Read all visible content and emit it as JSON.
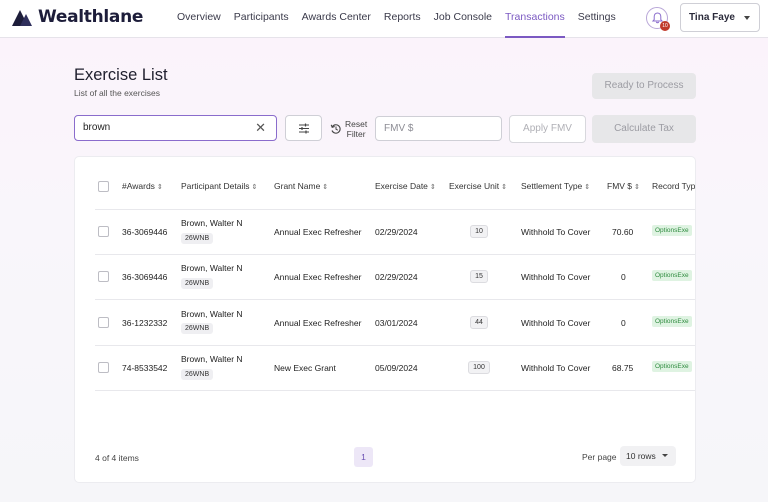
{
  "brand": {
    "name": "Wealthlane"
  },
  "nav": {
    "links": [
      "Overview",
      "Participants",
      "Awards Center",
      "Reports",
      "Job Console",
      "Transactions",
      "Settings"
    ],
    "active": "Transactions",
    "notification_count": "10",
    "user_name": "Tina Faye"
  },
  "page": {
    "title": "Exercise List",
    "subtitle": "List of all the exercises",
    "ready_button": "Ready to Process",
    "calculate_button": "Calculate Tax"
  },
  "toolbar": {
    "search_value": "brown",
    "reset_label_1": "Reset",
    "reset_label_2": "Filter",
    "fmv_placeholder": "FMV $",
    "apply_button": "Apply FMV"
  },
  "table": {
    "headers": [
      "#Awards",
      "Participant Details",
      "Grant Name",
      "Exercise Date",
      "Exercise Unit",
      "Settlement Type",
      "FMV $",
      "Record Typ"
    ],
    "rows": [
      {
        "award": "36-3069446",
        "name": "Brown, Walter N",
        "code": "26WNB",
        "grant": "Annual Exec Refresher",
        "date": "02/29/2024",
        "unit": "10",
        "settlement": "Withhold To Cover",
        "fmv": "70.60",
        "record": "OptionsExe"
      },
      {
        "award": "36-3069446",
        "name": "Brown, Walter N",
        "code": "26WNB",
        "grant": "Annual Exec Refresher",
        "date": "02/29/2024",
        "unit": "15",
        "settlement": "Withhold To Cover",
        "fmv": "0",
        "record": "OptionsExe"
      },
      {
        "award": "36-1232332",
        "name": "Brown, Walter N",
        "code": "26WNB",
        "grant": "Annual Exec Refresher",
        "date": "03/01/2024",
        "unit": "44",
        "settlement": "Withhold To Cover",
        "fmv": "0",
        "record": "OptionsExe"
      },
      {
        "award": "74-8533542",
        "name": "Brown, Walter N",
        "code": "26WNB",
        "grant": "New Exec Grant",
        "date": "05/09/2024",
        "unit": "100",
        "settlement": "Withhold To Cover",
        "fmv": "68.75",
        "record": "OptionsExe"
      }
    ]
  },
  "footer": {
    "count": "4 of 4 items",
    "page": "1",
    "per_page_label": "Per page",
    "rows_option": "10 rows"
  },
  "colors": {
    "accent": "#7b59c2",
    "brand_dark": "#1d1d3a",
    "badge": "#c0392b",
    "record_green": "#2e8b3e"
  }
}
